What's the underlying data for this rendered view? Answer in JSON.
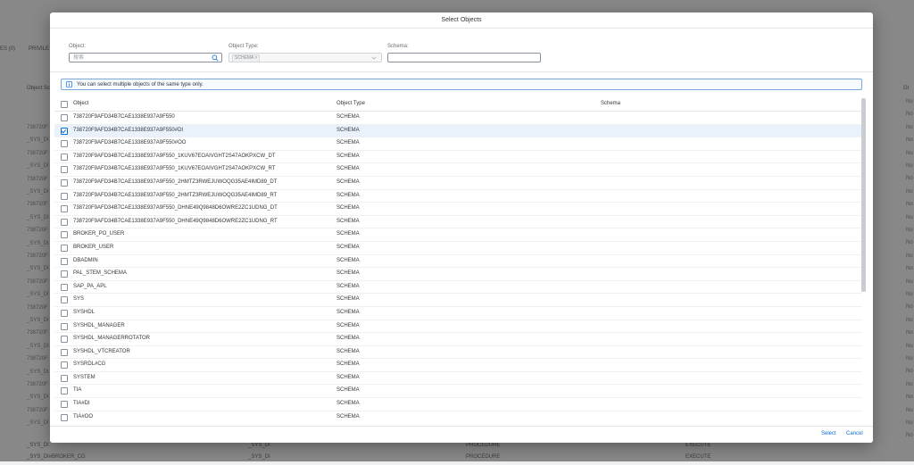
{
  "background": {
    "tabs": [
      "ES (0)",
      "PRIVILE"
    ],
    "column_header": "Object Sc",
    "right_header": "Gr",
    "left_rows": [
      "738720F",
      "_SYS_DI",
      "738720F",
      "_SYS_DI",
      "738720F",
      "_SYS_DI",
      "738720F",
      "_SYS_DI",
      "738720F",
      "_SYS_DI",
      "738720F",
      "_SYS_DI",
      "738720F",
      "_SYS_DI",
      "738720F",
      "_SYS_DI",
      "738720F",
      "_SYS_DI",
      "738720F",
      "_SYS_DI",
      "738720F",
      "_SYS_DI",
      "738720F",
      "_SYS_DI"
    ],
    "right_rows": [
      "No",
      "No",
      "No",
      "No",
      "No",
      "No",
      "No",
      "No",
      "No",
      "No",
      "No",
      "No",
      "No",
      "No",
      "No",
      "No",
      "No",
      "No",
      "No",
      "No",
      "No",
      "No",
      "No",
      "No",
      "No",
      "No",
      "No"
    ],
    "bottom_rows": [
      {
        "c1": "_SYS_DI",
        "c2": "_SYS_DI",
        "c3": "PROCEDURE",
        "c4": "EXECUTE"
      },
      {
        "c1": "_SYS_DI#BROKER_CG",
        "c2": "_SYS_DI",
        "c3": "PROCEDURE",
        "c4": "EXECUTE"
      }
    ]
  },
  "dialog": {
    "title": "Select Objects",
    "filters": {
      "object_label": "Object:",
      "object_placeholder": "搜索",
      "object_type_label": "Object Type:",
      "object_type_token": "SCHEMA ×",
      "schema_label": "Schema:",
      "schema_value": ""
    },
    "info": "You can select multiple objects of the same type only.",
    "table": {
      "headers": {
        "object": "Object",
        "object_type": "Object Type",
        "schema": "Schema"
      },
      "rows": [
        {
          "object": "738720F9AFD34B7CAE1338E937A9F550",
          "type": "SCHEMA",
          "schema": "",
          "checked": false
        },
        {
          "object": "738720F9AFD34B7CAE1338E937A9F550#DI",
          "type": "SCHEMA",
          "schema": "",
          "checked": true
        },
        {
          "object": "738720F9AFD34B7CAE1338E937A9F550#OO",
          "type": "SCHEMA",
          "schema": "",
          "checked": false
        },
        {
          "object": "738720F9AFD34B7CAE1338E937A9F550_1KUV67EOAIVGHT2S47AOKPXCW_DT",
          "type": "SCHEMA",
          "schema": "",
          "checked": false
        },
        {
          "object": "738720F9AFD34B7CAE1338E937A9F550_1KUV67EOAIVGHT2S47AOKPXCW_RT",
          "type": "SCHEMA",
          "schema": "",
          "checked": false
        },
        {
          "object": "738720F9AFD34B7CAE1338E937A9F550_2HMTZ3RWEJUWOQG35AE4IMD89_DT",
          "type": "SCHEMA",
          "schema": "",
          "checked": false
        },
        {
          "object": "738720F9AFD34B7CAE1338E937A9F550_2HMTZ3RWEJUWOQG35AE4IMD89_RT",
          "type": "SCHEMA",
          "schema": "",
          "checked": false
        },
        {
          "object": "738720F9AFD34B7CAE1338E937A9F550_DHNE49Q9848D6OWRE2ZC1UDNG_DT",
          "type": "SCHEMA",
          "schema": "",
          "checked": false
        },
        {
          "object": "738720F9AFD34B7CAE1338E937A9F550_DHNE49Q9848D6OWRE2ZC1UDNG_RT",
          "type": "SCHEMA",
          "schema": "",
          "checked": false
        },
        {
          "object": "BROKER_PO_USER",
          "type": "SCHEMA",
          "schema": "",
          "checked": false
        },
        {
          "object": "BROKER_USER",
          "type": "SCHEMA",
          "schema": "",
          "checked": false
        },
        {
          "object": "DBADMIN",
          "type": "SCHEMA",
          "schema": "",
          "checked": false
        },
        {
          "object": "PAL_STEM_SCHEMA",
          "type": "SCHEMA",
          "schema": "",
          "checked": false
        },
        {
          "object": "SAP_PA_APL",
          "type": "SCHEMA",
          "schema": "",
          "checked": false
        },
        {
          "object": "SYS",
          "type": "SCHEMA",
          "schema": "",
          "checked": false
        },
        {
          "object": "SYSHDL",
          "type": "SCHEMA",
          "schema": "",
          "checked": false
        },
        {
          "object": "SYSHDL_MANAGER",
          "type": "SCHEMA",
          "schema": "",
          "checked": false
        },
        {
          "object": "SYSHDL_MANAGERROTATOR",
          "type": "SCHEMA",
          "schema": "",
          "checked": false
        },
        {
          "object": "SYSHDL_VTCREATOR",
          "type": "SCHEMA",
          "schema": "",
          "checked": false
        },
        {
          "object": "SYSRDL#CG",
          "type": "SCHEMA",
          "schema": "",
          "checked": false
        },
        {
          "object": "SYSTEM",
          "type": "SCHEMA",
          "schema": "",
          "checked": false
        },
        {
          "object": "TIA",
          "type": "SCHEMA",
          "schema": "",
          "checked": false
        },
        {
          "object": "TIA#DI",
          "type": "SCHEMA",
          "schema": "",
          "checked": false
        },
        {
          "object": "TIA#OO",
          "type": "SCHEMA",
          "schema": "",
          "checked": false
        }
      ]
    },
    "footer": {
      "select_label": "Select",
      "cancel_label": "Cancel"
    }
  },
  "colors": {
    "accent": "#0a6ed1",
    "info_border": "#7aa7d8",
    "selected_row": "#e9f2fb"
  }
}
